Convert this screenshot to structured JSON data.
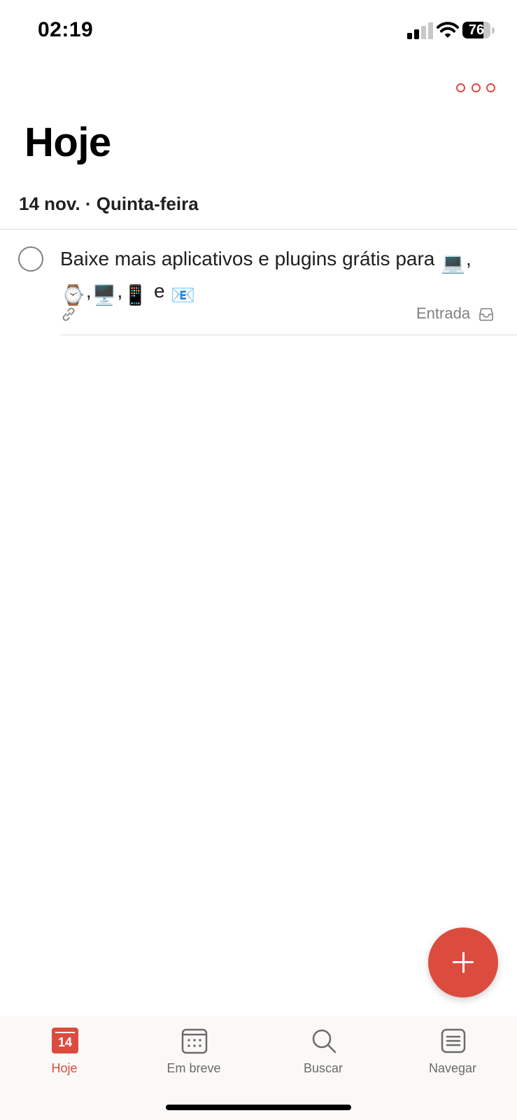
{
  "status_bar": {
    "time": "02:19",
    "battery": "76",
    "battery_level": 0.76
  },
  "header": {
    "more_icon": "more-horizontal-icon",
    "title": "Hoje",
    "date": "14 nov. · Quinta-feira"
  },
  "task": {
    "title_parts": {
      "p1": "Baixe mais aplicativos e plugins grátis para ",
      "e1": "💻",
      "p2": ",",
      "e2": "⌚",
      "p3": ",",
      "e3": "🖥️",
      "p4": ",",
      "e4": "📱",
      "p5": " e ",
      "e5": "📧"
    },
    "project": "Entrada",
    "icons": [
      "link-icon",
      "inbox-icon"
    ]
  },
  "fab": {
    "icon": "plus-icon"
  },
  "tabs": [
    {
      "label": "Hoje",
      "icon": "calendar-today-icon",
      "badge": "14",
      "active": true
    },
    {
      "label": "Em breve",
      "icon": "calendar-upcoming-icon",
      "active": false
    },
    {
      "label": "Buscar",
      "icon": "search-icon",
      "active": false
    },
    {
      "label": "Navegar",
      "icon": "browse-icon",
      "active": false
    }
  ],
  "colors": {
    "accent": "#dc4c3e",
    "text": "#202020",
    "muted": "#808080",
    "tab_bar_bg": "#faf9f7"
  }
}
